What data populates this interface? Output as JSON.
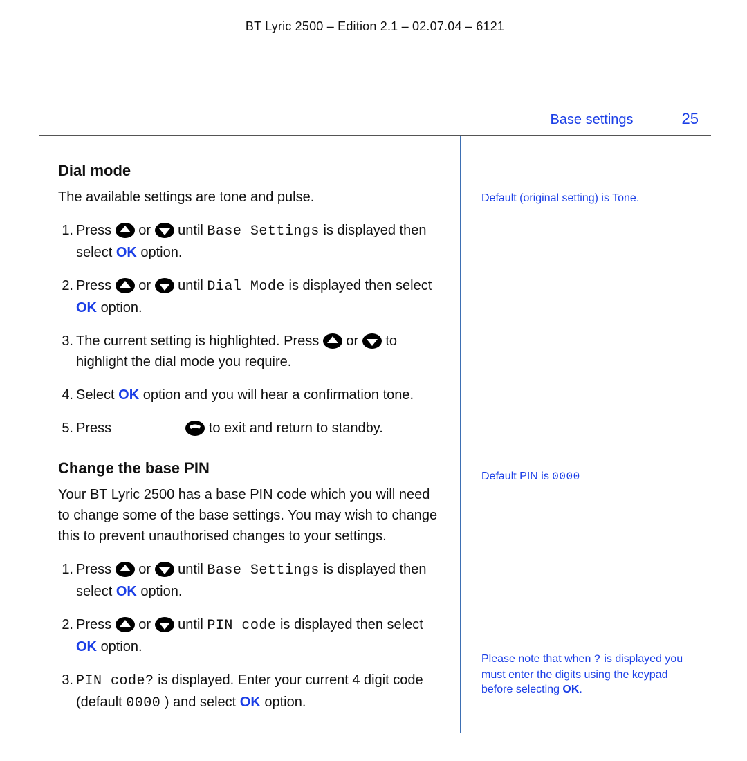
{
  "doc_header": "BT Lyric 2500 – Edition 2.1 – 02.07.04 – 6121",
  "section_title": "Base settings",
  "page_number": "25",
  "dial_mode": {
    "heading": "Dial mode",
    "intro": "The available settings are tone and pulse.",
    "steps": {
      "s1": {
        "num": "1.",
        "a": " Press ",
        "or": " or ",
        "b": " until ",
        "lcd": "Base Settings",
        "c": " is displayed then select ",
        "ok": "OK",
        "d": " option."
      },
      "s2": {
        "num": "2.",
        "a": "Press ",
        "or": " or ",
        "b": " until ",
        "lcd": "Dial Mode",
        "c": " is displayed then select ",
        "ok": "OK",
        "d": " option."
      },
      "s3": {
        "num": "3.",
        "a": "The current setting is highlighted. Press ",
        "or": " or ",
        "b": " to highlight the dial mode you require."
      },
      "s4": {
        "num": "4.",
        "a": "Select ",
        "ok": "OK",
        "b": " option and you will hear a confirmation tone."
      },
      "s5": {
        "num": "5.",
        "a": "Press ",
        "b": " to exit and return to standby."
      }
    }
  },
  "change_pin": {
    "heading": "Change the base PIN",
    "intro": "Your BT Lyric 2500 has a base PIN code which you will need to change some of the base settings. You may wish to change this to prevent unauthorised changes to your settings.",
    "steps": {
      "s1": {
        "num": "1.",
        "a": "Press ",
        "or": " or ",
        "b": " until ",
        "lcd": "Base Settings",
        "c": " is displayed then select ",
        "ok": "OK",
        "d": " option."
      },
      "s2": {
        "num": "2.",
        "a": "Press ",
        "or": " or ",
        "b": " until ",
        "lcd": "PIN code",
        "c": " is displayed then select ",
        "ok": "OK",
        "d": " option."
      },
      "s3": {
        "num": "3.",
        "lcd": "PIN code?",
        "a": " is displayed. Enter your current 4 digit code (default ",
        "lcd2": "0000",
        "b": ") and select ",
        "ok": "OK",
        "c": " option."
      }
    }
  },
  "side": {
    "note1": "Default (original setting) is Tone.",
    "note2_a": "Default PIN is ",
    "note2_pin": "0000",
    "note3_a": "Please note that when ",
    "note3_q": "?",
    "note3_b": " is displayed you must enter the digits using the keypad before selecting ",
    "note3_ok": "OK",
    "note3_c": "."
  }
}
